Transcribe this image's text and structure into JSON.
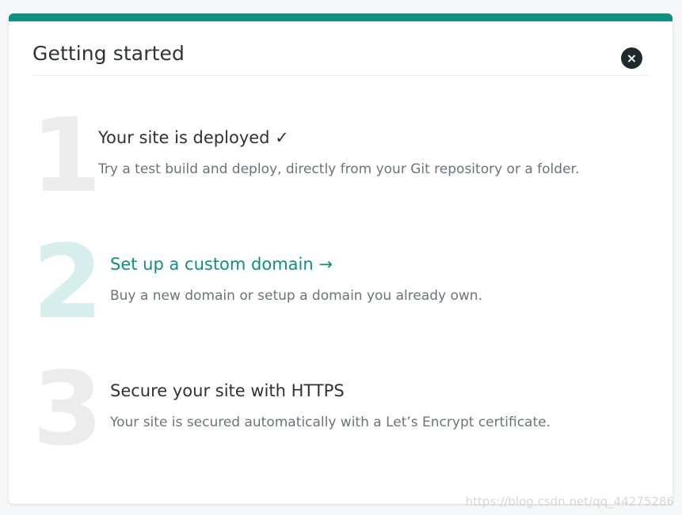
{
  "header": {
    "title": "Getting started",
    "close_icon": "×"
  },
  "steps": [
    {
      "number": "1",
      "title": "Your site is deployed ✓",
      "description": "Try a test build and deploy, directly from your Git repository or a folder."
    },
    {
      "number": "2",
      "title": "Set up a custom domain →",
      "description": "Buy a new domain or setup a domain you already own."
    },
    {
      "number": "3",
      "title": "Secure your site with HTTPS",
      "description": "Your site is secured automatically with a Let’s Encrypt certificate."
    }
  ],
  "watermark": "https://blog.csdn.net/qq_44275286",
  "colors": {
    "accent": "#0f8f80",
    "close_bg": "#1e2a2f",
    "number_inactive": "#ececec",
    "number_active": "#d7efec"
  }
}
